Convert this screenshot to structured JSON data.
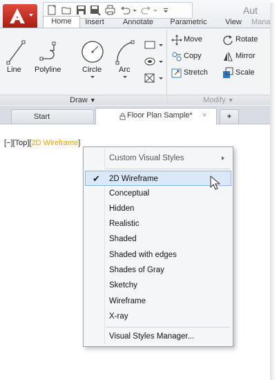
{
  "app": {
    "title": "Aut"
  },
  "ribbon_tabs": [
    "Home",
    "Insert",
    "Annotate",
    "Parametric",
    "View",
    "Mana"
  ],
  "draw_panel": {
    "title": "Draw",
    "tools": [
      "Line",
      "Polyline",
      "Circle",
      "Arc"
    ]
  },
  "modify_panel": {
    "title": "Modify",
    "tools": [
      "Move",
      "Rotate",
      "Copy",
      "Mirror",
      "Stretch",
      "Scale"
    ]
  },
  "doc_tabs": {
    "start": "Start",
    "active": "Floor Plan Sample*",
    "close": "×",
    "add": "+"
  },
  "viewport_label": {
    "prefix": "[−][Top][",
    "style": "2D Wireframe",
    "suffix": "]"
  },
  "menu": {
    "header": "Custom Visual Styles",
    "items": [
      "2D Wireframe",
      "Conceptual",
      "Hidden",
      "Realistic",
      "Shaded",
      "Shaded with edges",
      "Shades of Gray",
      "Sketchy",
      "Wireframe",
      "X-ray"
    ],
    "checked_item": "2D Wireframe",
    "checkmark": "✔",
    "footer": "Visual Styles Manager..."
  },
  "colors": {
    "accent_red": "#c62b1e",
    "highlight": "#e0a800",
    "hover_bg": "#dbe8f8"
  }
}
